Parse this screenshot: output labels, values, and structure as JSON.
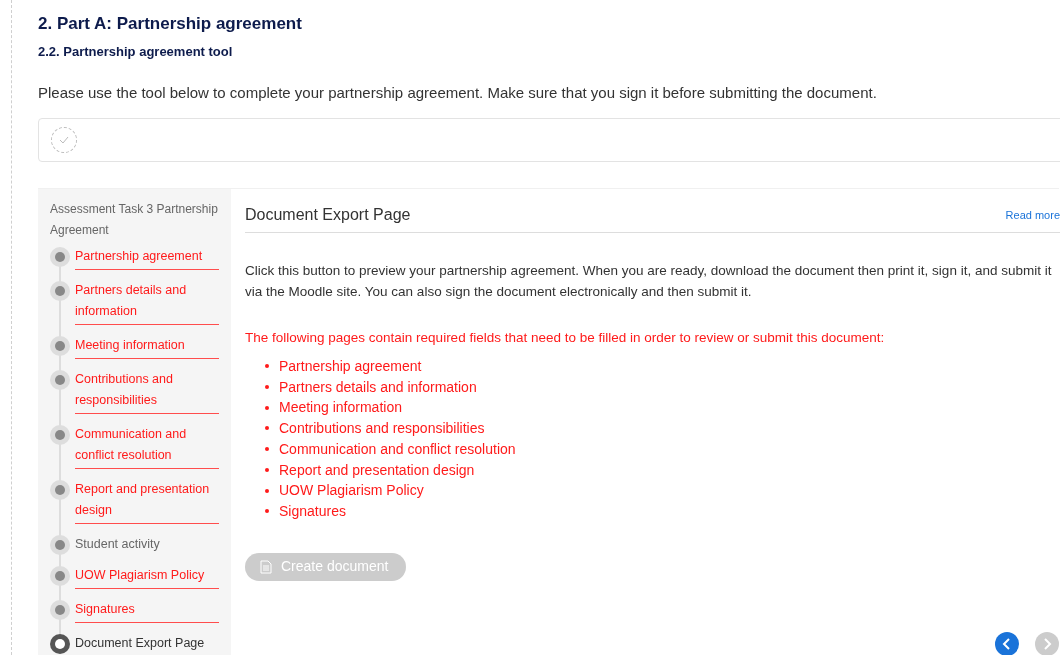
{
  "heading": "2. Part A: Partnership agreement",
  "subheading": "2.2. Partnership agreement tool",
  "intro": "Please use the tool below to complete your partnership agreement. Make sure that you sign it before submitting the document.",
  "completion": {
    "checked": false
  },
  "sidebar": {
    "title": "Assessment Task 3 Partnership Agreement",
    "items": [
      {
        "label": "Partnership agreement",
        "incomplete": true,
        "selected": false
      },
      {
        "label": "Partners details and information",
        "incomplete": true,
        "selected": false
      },
      {
        "label": "Meeting information",
        "incomplete": true,
        "selected": false
      },
      {
        "label": "Contributions and responsibilities",
        "incomplete": true,
        "selected": false
      },
      {
        "label": "Communication and conflict resolution",
        "incomplete": true,
        "selected": false
      },
      {
        "label": "Report and presentation design",
        "incomplete": true,
        "selected": false
      },
      {
        "label": "Student activity",
        "incomplete": false,
        "selected": false
      },
      {
        "label": "UOW Plagiarism Policy",
        "incomplete": true,
        "selected": false
      },
      {
        "label": "Signatures",
        "incomplete": true,
        "selected": false
      },
      {
        "label": "Document Export Page",
        "incomplete": false,
        "selected": true
      }
    ]
  },
  "page": {
    "title": "Document Export Page",
    "read_more": "Read more",
    "description": "Click this button to preview your partnership agreement. When you are ready, download the document then print it, sign it, and submit it via the Moodle site. You can also sign the document electronically and then submit it.",
    "warning": "The following pages contain required fields that need to be filled in order to review or submit this document:",
    "missing": [
      "Partnership agreement",
      "Partners details and information",
      "Meeting information",
      "Contributions and responsibilities",
      "Communication and conflict resolution",
      "Report and presentation design",
      "UOW Plagiarism Policy",
      "Signatures"
    ],
    "create_button": {
      "label": "Create document",
      "disabled": true
    },
    "prev": {
      "disabled": false
    },
    "next": {
      "disabled": true
    }
  }
}
